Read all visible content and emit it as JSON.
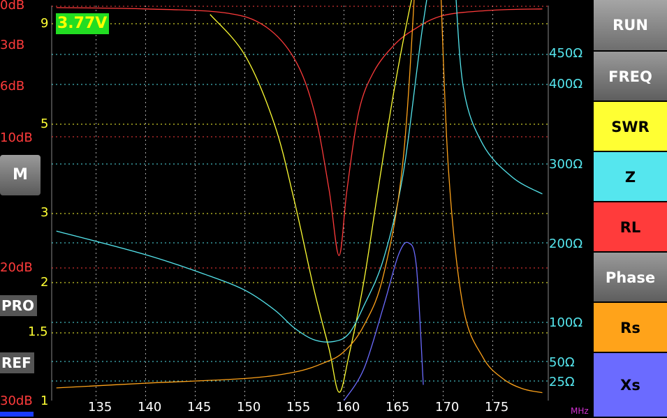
{
  "voltage": "3.77V",
  "left_buttons": {
    "m": "M",
    "pro": "PRO",
    "ref": "REF"
  },
  "rl_labels": [
    "0dB",
    "3dB",
    "6dB",
    "10dB",
    "20dB",
    "30dB"
  ],
  "swr_labels": [
    "9",
    "5",
    "3",
    "2",
    "1.5",
    "1"
  ],
  "z_labels": [
    "450Ω",
    "400Ω",
    "300Ω",
    "200Ω",
    "100Ω",
    "50Ω",
    "25Ω"
  ],
  "freq_ticks": [
    "135",
    "140",
    "145",
    "150",
    "155",
    "160",
    "165",
    "170",
    "175"
  ],
  "freq_unit": "MHz",
  "side_buttons": [
    "RUN",
    "FREQ",
    "SWR",
    "Z",
    "RL",
    "Phase",
    "Rs",
    "Xs"
  ],
  "colors": {
    "rl": "#ff3b3b",
    "swr": "#ffff33",
    "z": "#55e6ee",
    "rs": "#ffa31a",
    "xs": "#6b6bff",
    "voltage_bg": "#22dd22",
    "voltage_text": "#ffff00"
  },
  "chart_data": {
    "type": "line",
    "x_range": [
      131,
      180
    ],
    "x_ticks": [
      135,
      140,
      145,
      150,
      155,
      160,
      165,
      170,
      175
    ],
    "xlabel": "MHz",
    "series": [
      {
        "name": "RL",
        "points": [
          [
            131,
            0.1
          ],
          [
            140,
            0.2
          ],
          [
            148,
            0.5
          ],
          [
            152,
            1.5
          ],
          [
            155,
            4
          ],
          [
            157,
            8
          ],
          [
            158.5,
            14
          ],
          [
            159.5,
            19
          ],
          [
            160.3,
            14
          ],
          [
            161.5,
            8
          ],
          [
            163,
            5
          ],
          [
            165,
            3
          ],
          [
            167,
            1.8
          ],
          [
            170,
            0.7
          ],
          [
            175,
            0.3
          ],
          [
            180,
            0.2
          ]
        ]
      },
      {
        "name": "SWR",
        "points": [
          [
            146.5,
            9.5
          ],
          [
            150,
            7.5
          ],
          [
            153,
            5
          ],
          [
            155,
            3.2
          ],
          [
            157,
            1.9
          ],
          [
            158.5,
            1.35
          ],
          [
            159.5,
            1.05
          ],
          [
            160.5,
            1.3
          ],
          [
            162,
            2
          ],
          [
            163.5,
            3.5
          ],
          [
            165,
            6
          ],
          [
            166.5,
            9.5
          ],
          [
            168,
            14
          ]
        ]
      },
      {
        "name": "Z",
        "points": [
          [
            131,
            215
          ],
          [
            140,
            185
          ],
          [
            146,
            160
          ],
          [
            150,
            140
          ],
          [
            153,
            115
          ],
          [
            155,
            92
          ],
          [
            157,
            77
          ],
          [
            159,
            75
          ],
          [
            160.5,
            85
          ],
          [
            162,
            120
          ],
          [
            164,
            180
          ],
          [
            166,
            290
          ],
          [
            168,
            480
          ],
          [
            170,
            620
          ],
          [
            171,
            560
          ],
          [
            172,
            400
          ],
          [
            174,
            325
          ],
          [
            177,
            283
          ],
          [
            180,
            262
          ]
        ]
      },
      {
        "name": "Rs",
        "points": [
          [
            131,
            16
          ],
          [
            140,
            22
          ],
          [
            150,
            28
          ],
          [
            155,
            36
          ],
          [
            158,
            48
          ],
          [
            160,
            62
          ],
          [
            162,
            95
          ],
          [
            164,
            160
          ],
          [
            166,
            310
          ],
          [
            167.5,
            600
          ],
          [
            168.5,
            800
          ],
          [
            169.5,
            600
          ],
          [
            170.5,
            300
          ],
          [
            172,
            120
          ],
          [
            174,
            55
          ],
          [
            176,
            28
          ],
          [
            178,
            15
          ],
          [
            180,
            10
          ]
        ]
      },
      {
        "name": "Xs",
        "points": [
          [
            160,
            0
          ],
          [
            162,
            40
          ],
          [
            164,
            120
          ],
          [
            165.5,
            185
          ],
          [
            166.5,
            200
          ],
          [
            167.3,
            170
          ],
          [
            168,
            20
          ]
        ]
      }
    ]
  }
}
